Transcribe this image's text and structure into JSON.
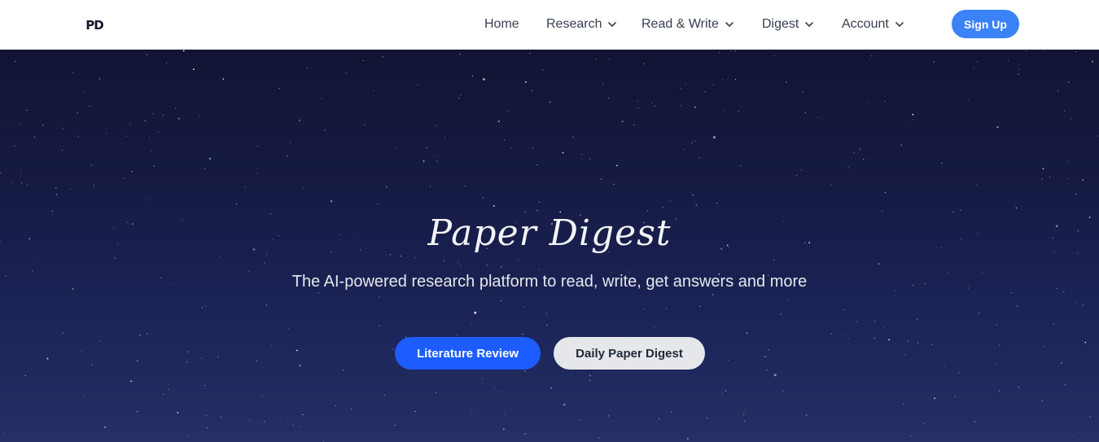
{
  "header": {
    "logo_text": "PD",
    "nav": [
      {
        "label": "Home",
        "has_dropdown": false
      },
      {
        "label": "Research",
        "has_dropdown": true
      },
      {
        "label": "Read & Write",
        "has_dropdown": true
      },
      {
        "label": "Digest",
        "has_dropdown": true
      },
      {
        "label": "Account",
        "has_dropdown": true
      }
    ],
    "signup_label": "Sign Up"
  },
  "hero": {
    "title": "Paper Digest",
    "subtitle": "The AI-powered research platform to read, write, get answers and more",
    "primary_button": "Literature Review",
    "secondary_button": "Daily Paper Digest"
  },
  "icons": {
    "dropdown": "chevron-down-icon"
  },
  "colors": {
    "accent": "#3b82f6",
    "primary_button": "#1d5cff",
    "hero_background": "#161b44"
  }
}
